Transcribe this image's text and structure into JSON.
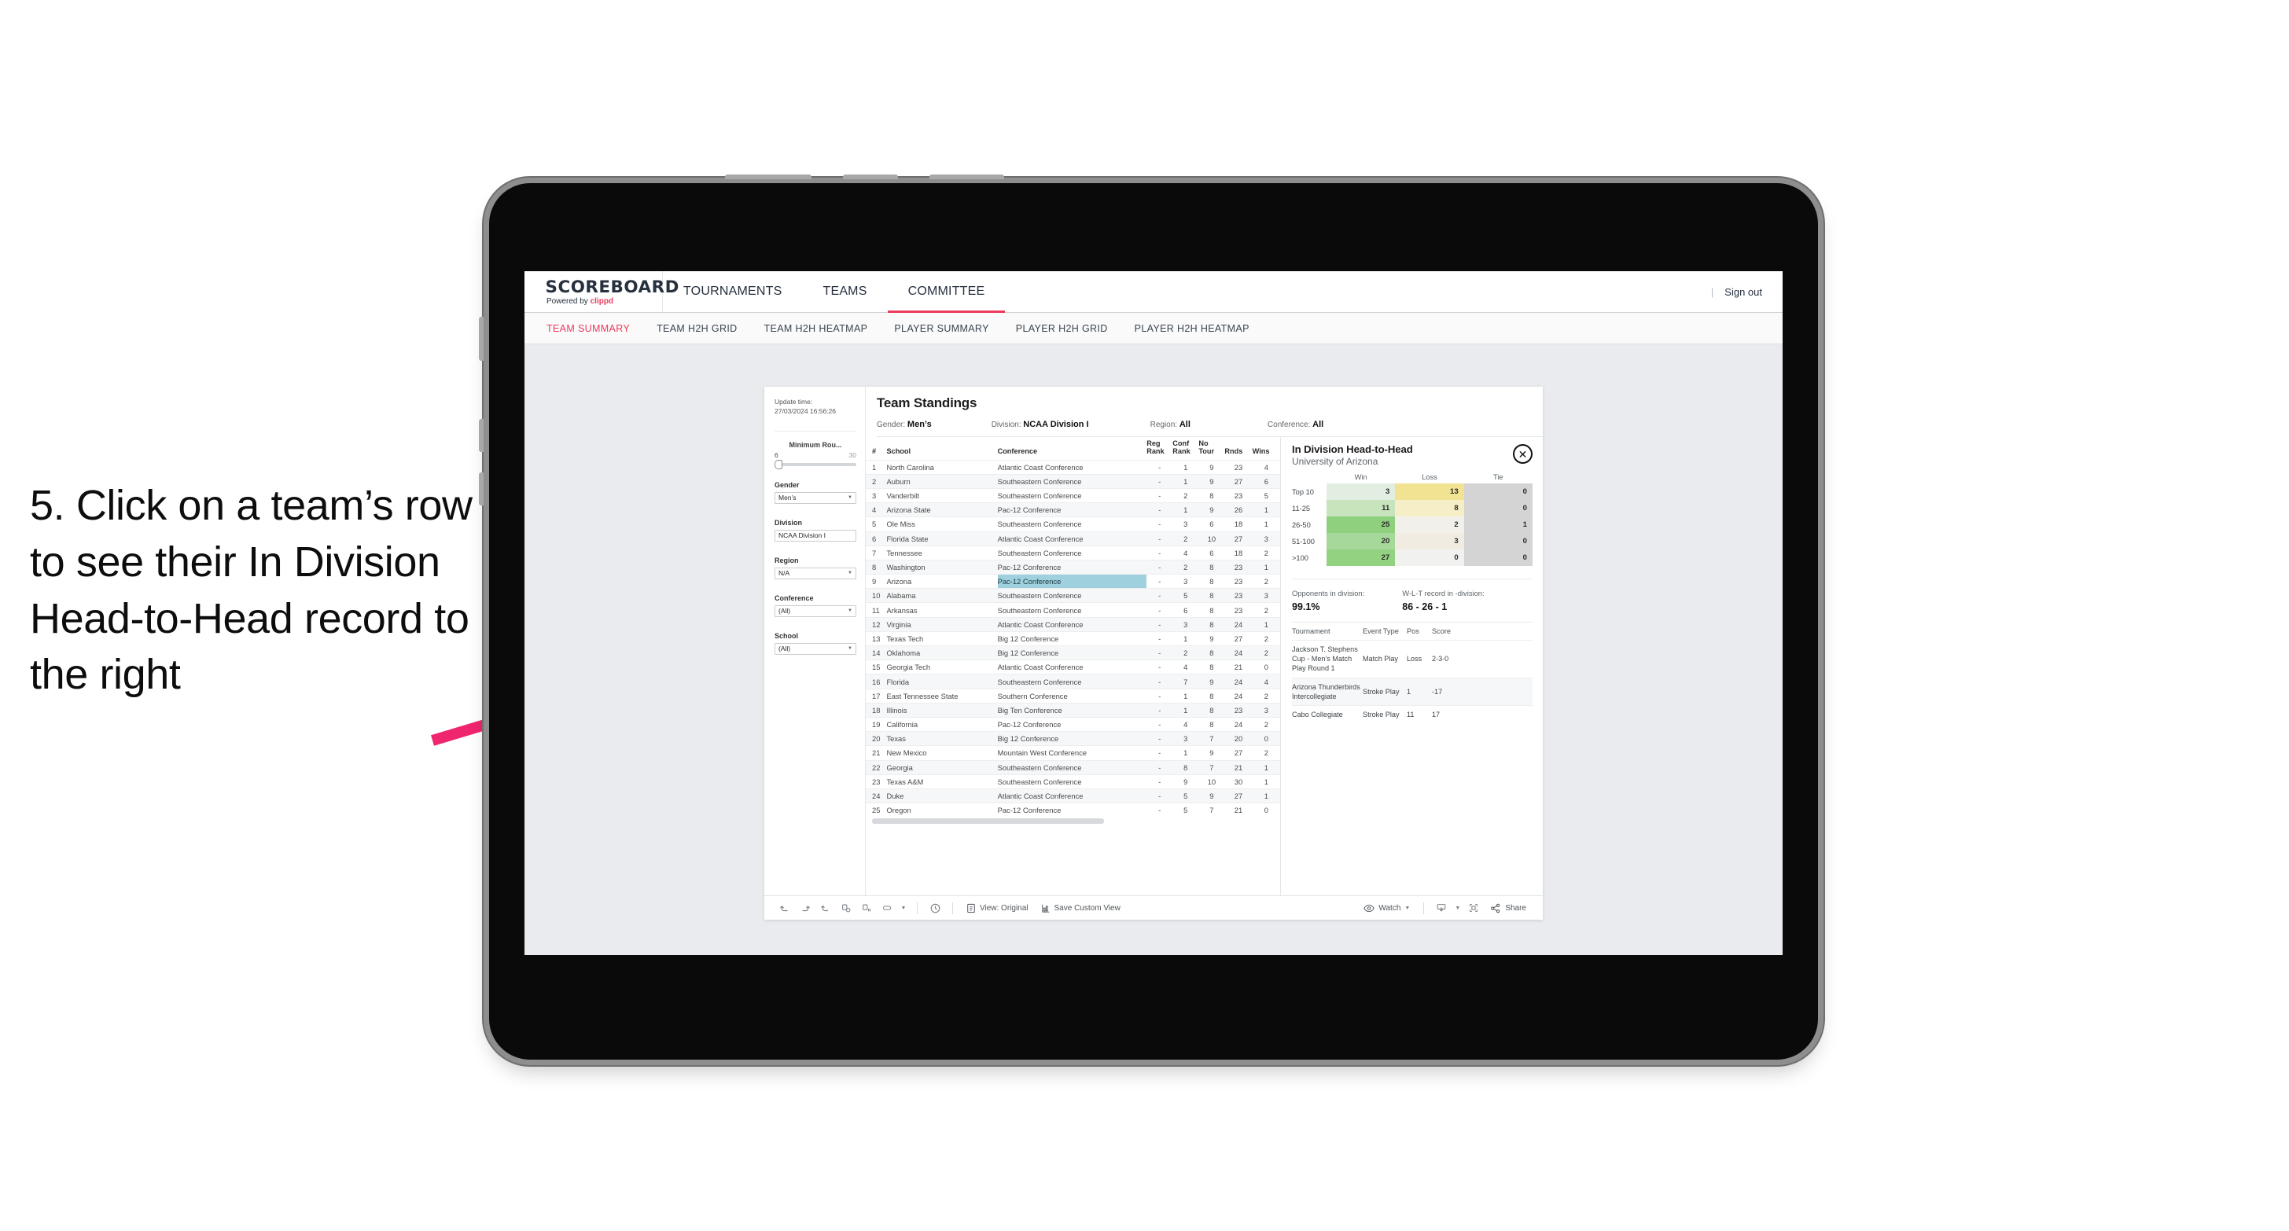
{
  "annotation": {
    "text": "5. Click on a team’s row to see their In Division Head-to-Head record to the right",
    "arrow_color": "#f0256f"
  },
  "header": {
    "logo_main": "SCOREBOARD",
    "logo_sub_prefix": "Powered by ",
    "logo_sub_brand": "clippd",
    "nav": [
      {
        "label": "TOURNAMENTS",
        "active": false
      },
      {
        "label": "TEAMS",
        "active": false
      },
      {
        "label": "COMMITTEE",
        "active": true
      }
    ],
    "divider": "|",
    "signout": "Sign out",
    "accent": "#ec3a5d"
  },
  "subnav": [
    {
      "label": "TEAM SUMMARY",
      "active": true
    },
    {
      "label": "TEAM H2H GRID",
      "active": false
    },
    {
      "label": "TEAM H2H HEATMAP",
      "active": false
    },
    {
      "label": "PLAYER SUMMARY",
      "active": false
    },
    {
      "label": "PLAYER H2H GRID",
      "active": false
    },
    {
      "label": "PLAYER H2H HEATMAP",
      "active": false
    }
  ],
  "filters": {
    "update_label": "Update time:",
    "update_value": "27/03/2024 16:56:26",
    "min_rounds": {
      "title": "Minimum Rou...",
      "min": "6",
      "max": "30"
    },
    "gender": {
      "title": "Gender",
      "value": "Men’s"
    },
    "division": {
      "title": "Division",
      "value": "NCAA Division I"
    },
    "region": {
      "title": "Region",
      "value": "N/A"
    },
    "conference": {
      "title": "Conference",
      "value": "(All)"
    },
    "school": {
      "title": "School",
      "value": "(All)"
    }
  },
  "standings": {
    "title": "Team Standings",
    "meta": [
      {
        "label": "Gender:",
        "value": "Men’s"
      },
      {
        "label": "Division:",
        "value": "NCAA Division I"
      },
      {
        "label": "Region:",
        "value": "All"
      },
      {
        "label": "Conference:",
        "value": "All"
      }
    ],
    "columns": [
      "#",
      "School",
      "Conference",
      "Reg Rank",
      "Conf Rank",
      "No Tour",
      "Rnds",
      "Wins"
    ],
    "rows": [
      {
        "n": "1",
        "school": "North Carolina",
        "conf": "Atlantic Coast Conference",
        "reg": "-",
        "cr": "1",
        "nt": "9",
        "rn": "23",
        "wn": "4"
      },
      {
        "n": "2",
        "school": "Auburn",
        "conf": "Southeastern Conference",
        "reg": "-",
        "cr": "1",
        "nt": "9",
        "rn": "27",
        "wn": "6"
      },
      {
        "n": "3",
        "school": "Vanderbilt",
        "conf": "Southeastern Conference",
        "reg": "-",
        "cr": "2",
        "nt": "8",
        "rn": "23",
        "wn": "5"
      },
      {
        "n": "4",
        "school": "Arizona State",
        "conf": "Pac-12 Conference",
        "reg": "-",
        "cr": "1",
        "nt": "9",
        "rn": "26",
        "wn": "1"
      },
      {
        "n": "5",
        "school": "Ole Miss",
        "conf": "Southeastern Conference",
        "reg": "-",
        "cr": "3",
        "nt": "6",
        "rn": "18",
        "wn": "1"
      },
      {
        "n": "6",
        "school": "Florida State",
        "conf": "Atlantic Coast Conference",
        "reg": "-",
        "cr": "2",
        "nt": "10",
        "rn": "27",
        "wn": "3"
      },
      {
        "n": "7",
        "school": "Tennessee",
        "conf": "Southeastern Conference",
        "reg": "-",
        "cr": "4",
        "nt": "6",
        "rn": "18",
        "wn": "2"
      },
      {
        "n": "8",
        "school": "Washington",
        "conf": "Pac-12 Conference",
        "reg": "-",
        "cr": "2",
        "nt": "8",
        "rn": "23",
        "wn": "1"
      },
      {
        "n": "9",
        "school": "Arizona",
        "conf": "Pac-12 Conference",
        "reg": "-",
        "cr": "3",
        "nt": "8",
        "rn": "23",
        "wn": "2",
        "selected": true
      },
      {
        "n": "10",
        "school": "Alabama",
        "conf": "Southeastern Conference",
        "reg": "-",
        "cr": "5",
        "nt": "8",
        "rn": "23",
        "wn": "3"
      },
      {
        "n": "11",
        "school": "Arkansas",
        "conf": "Southeastern Conference",
        "reg": "-",
        "cr": "6",
        "nt": "8",
        "rn": "23",
        "wn": "2"
      },
      {
        "n": "12",
        "school": "Virginia",
        "conf": "Atlantic Coast Conference",
        "reg": "-",
        "cr": "3",
        "nt": "8",
        "rn": "24",
        "wn": "1"
      },
      {
        "n": "13",
        "school": "Texas Tech",
        "conf": "Big 12 Conference",
        "reg": "-",
        "cr": "1",
        "nt": "9",
        "rn": "27",
        "wn": "2"
      },
      {
        "n": "14",
        "school": "Oklahoma",
        "conf": "Big 12 Conference",
        "reg": "-",
        "cr": "2",
        "nt": "8",
        "rn": "24",
        "wn": "2"
      },
      {
        "n": "15",
        "school": "Georgia Tech",
        "conf": "Atlantic Coast Conference",
        "reg": "-",
        "cr": "4",
        "nt": "8",
        "rn": "21",
        "wn": "0"
      },
      {
        "n": "16",
        "school": "Florida",
        "conf": "Southeastern Conference",
        "reg": "-",
        "cr": "7",
        "nt": "9",
        "rn": "24",
        "wn": "4"
      },
      {
        "n": "17",
        "school": "East Tennessee State",
        "conf": "Southern Conference",
        "reg": "-",
        "cr": "1",
        "nt": "8",
        "rn": "24",
        "wn": "2"
      },
      {
        "n": "18",
        "school": "Illinois",
        "conf": "Big Ten Conference",
        "reg": "-",
        "cr": "1",
        "nt": "8",
        "rn": "23",
        "wn": "3"
      },
      {
        "n": "19",
        "school": "California",
        "conf": "Pac-12 Conference",
        "reg": "-",
        "cr": "4",
        "nt": "8",
        "rn": "24",
        "wn": "2"
      },
      {
        "n": "20",
        "school": "Texas",
        "conf": "Big 12 Conference",
        "reg": "-",
        "cr": "3",
        "nt": "7",
        "rn": "20",
        "wn": "0"
      },
      {
        "n": "21",
        "school": "New Mexico",
        "conf": "Mountain West Conference",
        "reg": "-",
        "cr": "1",
        "nt": "9",
        "rn": "27",
        "wn": "2"
      },
      {
        "n": "22",
        "school": "Georgia",
        "conf": "Southeastern Conference",
        "reg": "-",
        "cr": "8",
        "nt": "7",
        "rn": "21",
        "wn": "1"
      },
      {
        "n": "23",
        "school": "Texas A&M",
        "conf": "Southeastern Conference",
        "reg": "-",
        "cr": "9",
        "nt": "10",
        "rn": "30",
        "wn": "1"
      },
      {
        "n": "24",
        "school": "Duke",
        "conf": "Atlantic Coast Conference",
        "reg": "-",
        "cr": "5",
        "nt": "9",
        "rn": "27",
        "wn": "1"
      },
      {
        "n": "25",
        "school": "Oregon",
        "conf": "Pac-12 Conference",
        "reg": "-",
        "cr": "5",
        "nt": "7",
        "rn": "21",
        "wn": "0"
      }
    ],
    "selected_highlight_color": "#9fd0dd"
  },
  "h2h": {
    "title": "In Division Head-to-Head",
    "subtitle": "University of Arizona",
    "close_icon": "✕",
    "stats": [
      {
        "label": "Opponents in division:",
        "value": "99.1%"
      },
      {
        "label": "W-L-T record in -division:",
        "value": "86 - 26 - 1"
      }
    ],
    "tournaments_columns": [
      "Tournament",
      "Event Type",
      "Pos",
      "Score"
    ],
    "tournaments": [
      {
        "name": "Jackson T. Stephens Cup - Men’s Match Play Round 1",
        "type": "Match Play",
        "pos": "Loss",
        "score": "2-3-0"
      },
      {
        "name": "Arizona Thunderbirds Intercollegiate",
        "type": "Stroke Play",
        "pos": "1",
        "score": "-17"
      },
      {
        "name": "Cabo Collegiate",
        "type": "Stroke Play",
        "pos": "11",
        "score": "17"
      }
    ]
  },
  "chart_data": {
    "type": "heatmap",
    "title": "In Division Head-to-Head",
    "subtitle": "University of Arizona",
    "columns": [
      "Win",
      "Loss",
      "Tie"
    ],
    "rows": [
      "Top 10",
      "11-25",
      "26-50",
      "51-100",
      ">100"
    ],
    "values": [
      [
        3,
        13,
        0
      ],
      [
        11,
        8,
        0
      ],
      [
        25,
        2,
        1
      ],
      [
        20,
        3,
        0
      ],
      [
        27,
        0,
        0
      ]
    ],
    "cell_colors": [
      [
        "#e2eee1",
        "#f2e393",
        "#d4d4d4"
      ],
      [
        "#c8e4bd",
        "#f5eec6",
        "#d4d4d4"
      ],
      [
        "#8fd07f",
        "#f2f0ea",
        "#d4d4d4"
      ],
      [
        "#a6d899",
        "#f0ece1",
        "#d4d4d4"
      ],
      [
        "#93d281",
        "#f1f1ef",
        "#d4d4d4"
      ]
    ],
    "legend": "none",
    "grid": false
  },
  "toolbar": {
    "icons": [
      "undo-icon",
      "redo-icon",
      "revert-icon",
      "refresh-data-icon",
      "pause-updates-icon",
      "view-shape-icon"
    ],
    "alerts_icon": "alerts-icon",
    "view_label": "View: Original",
    "save_label": "Save Custom View",
    "watch_label": "Watch",
    "download_icon": "download-icon",
    "fullscreen_icon": "fullscreen-icon",
    "share_label": "Share"
  }
}
